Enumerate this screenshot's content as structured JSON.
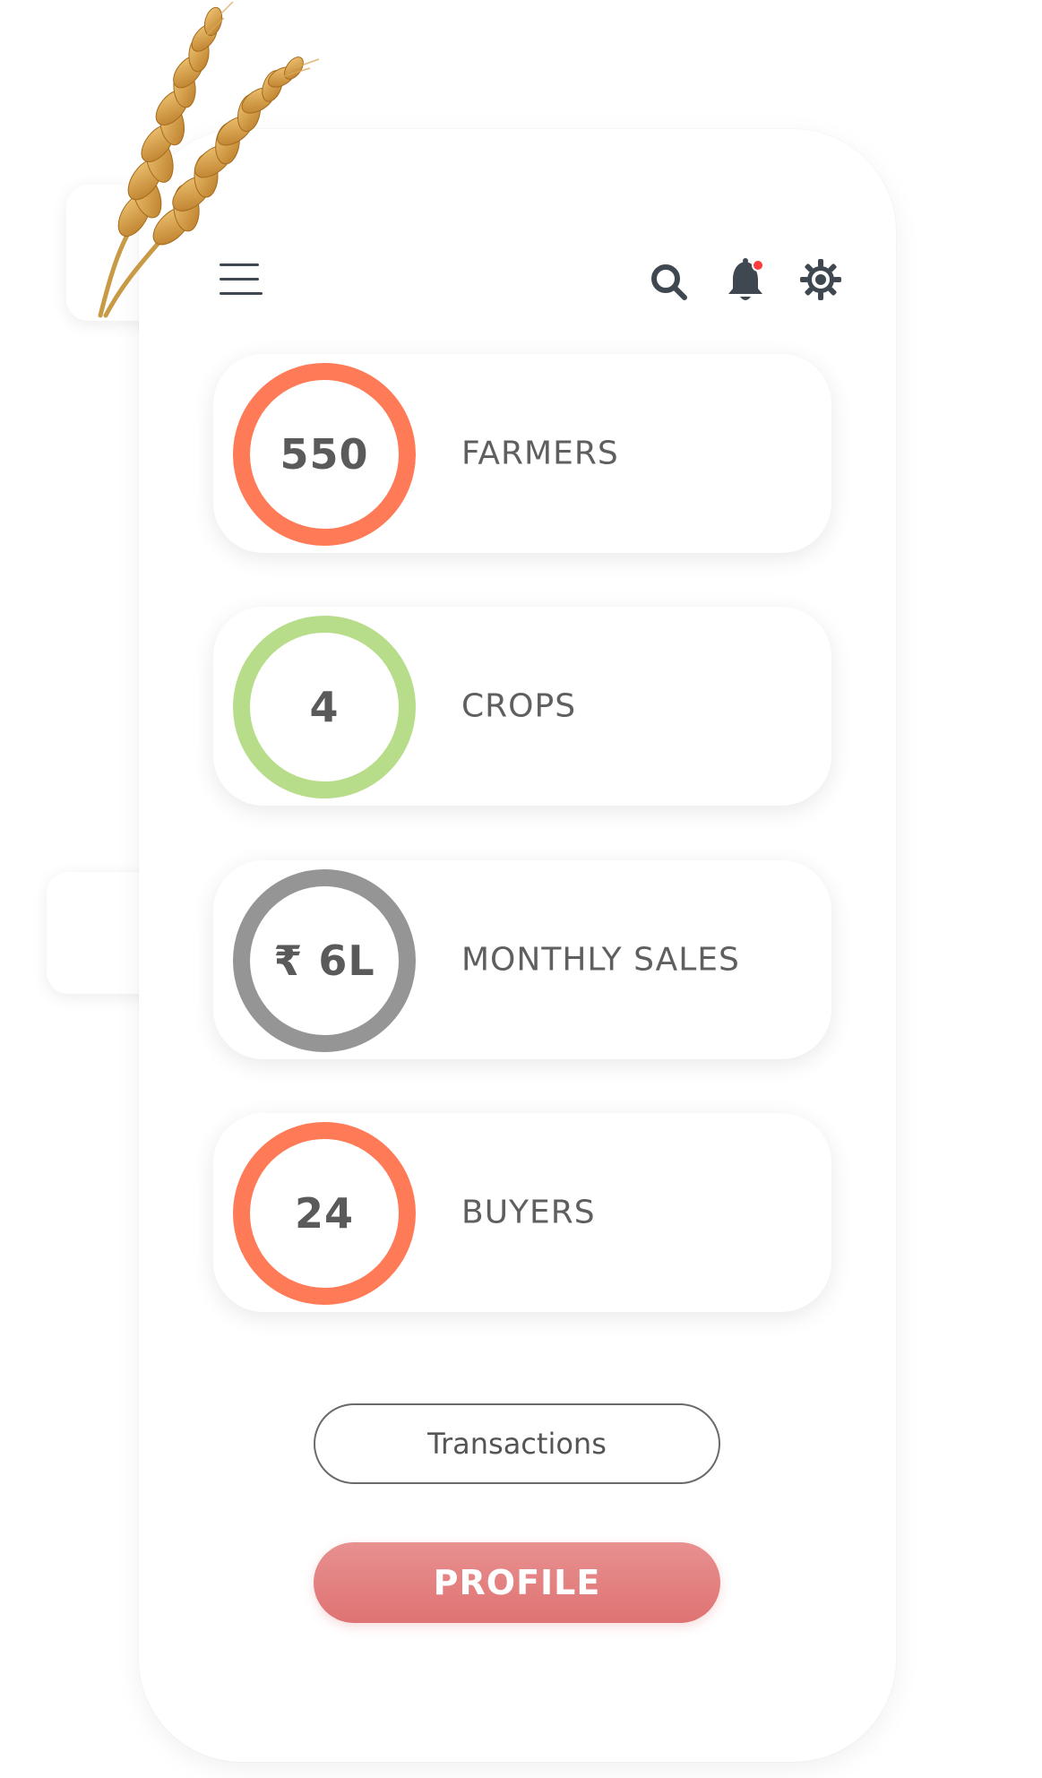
{
  "header": {
    "icons": [
      "menu-icon",
      "search-icon",
      "notification-bell-icon",
      "settings-gear-icon"
    ],
    "notification_dot_color": "#ff3b3b"
  },
  "stats": [
    {
      "value": "550",
      "label": "FARMERS",
      "ring_color": "#ff7a56"
    },
    {
      "value": "4",
      "label": "CROPS",
      "ring_color": "#b7dd8a"
    },
    {
      "value": "₹ 6L",
      "label": "MONTHLY SALES",
      "ring_color": "#959595"
    },
    {
      "value": "24",
      "label": "BUYERS",
      "ring_color": "#ff7a56"
    }
  ],
  "buttons": {
    "transactions_label": "Transactions",
    "profile_label": "PROFILE"
  },
  "colors": {
    "accent_primary": "#df7373",
    "ring_orange": "#ff7a56",
    "ring_green": "#b7dd8a",
    "ring_gray": "#959595",
    "icon_dark": "#3f4750",
    "wheat_gold": "#d9a54c"
  }
}
